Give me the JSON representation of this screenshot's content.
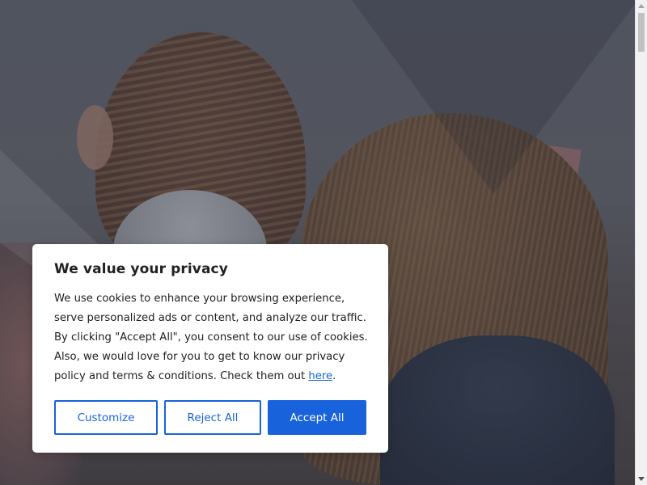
{
  "cookie_banner": {
    "title": "We value your privacy",
    "body_text": "We use cookies to enhance your browsing experience, serve personalized ads or content, and analyze our traffic. By clicking \"Accept All\", you consent to our use of cookies. Also, we would love for you to get to know our privacy policy and terms & conditions. Check them out ",
    "link_label": "here",
    "trailing_text": ".",
    "buttons": {
      "customize": "Customize",
      "reject_all": "Reject All",
      "accept_all": "Accept All"
    }
  },
  "colors": {
    "accent": "#1863dc",
    "dialog_background": "#ffffff",
    "text": "#212121"
  }
}
